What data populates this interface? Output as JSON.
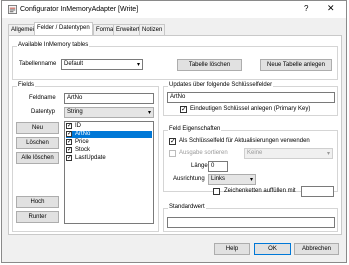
{
  "window": {
    "title": "Configurator InMemoryAdapter [Write]",
    "help_glyph": "?",
    "close_glyph": "✕"
  },
  "tabs": [
    "Allgemein",
    "Felder / Datentypen",
    "Format",
    "Erweitert",
    "Notizen"
  ],
  "tables_group": {
    "title": "Available InMemory tables",
    "table_name_label": "Tabellenname",
    "table_name_value": "Default",
    "delete_button": "Tabelle löschen",
    "new_button": "Neue Tabelle anlegen"
  },
  "fields_group": {
    "title": "Fields",
    "field_name_label": "Feldname",
    "field_name_value": "ArtNo",
    "datatype_label": "Datentyp",
    "datatype_value": "String",
    "new_button": "Neu",
    "delete_button": "Löschen",
    "delete_all_button": "Alle löschen",
    "up_button": "Hoch",
    "down_button": "Runter",
    "fields": [
      {
        "name": "ID",
        "checked": true,
        "selected": false
      },
      {
        "name": "ArtNo",
        "checked": true,
        "selected": true
      },
      {
        "name": "Price",
        "checked": true,
        "selected": false
      },
      {
        "name": "Stock",
        "checked": true,
        "selected": false
      },
      {
        "name": "LastUpdate",
        "checked": true,
        "selected": false
      }
    ]
  },
  "updates_group": {
    "title": "Updates über folgende Schlüsselfelder",
    "key_fields_value": "ArtNo",
    "unique_key_label": "Eindeutigen Schlüssel anlegen (Primary Key)",
    "unique_key_checked": true
  },
  "props_group": {
    "title": "Feld Eigenschaften",
    "as_key_label": "Als Schlüsselfeld für Aktualisierungen verwenden",
    "as_key_checked": true,
    "sort_label": "Ausgabe sortieren",
    "sort_checked": false,
    "sort_value": "Keine",
    "length_label": "Länge",
    "length_value": "0",
    "align_label": "Ausrichtung",
    "align_value": "Links",
    "fill_label": "Zeichenketten auffüllen mit",
    "fill_checked": false,
    "fill_value": ""
  },
  "default_group": {
    "title": "Standardwert",
    "value": ""
  },
  "footer": {
    "help": "Help",
    "ok": "OK",
    "cancel": "Abbrechen"
  }
}
